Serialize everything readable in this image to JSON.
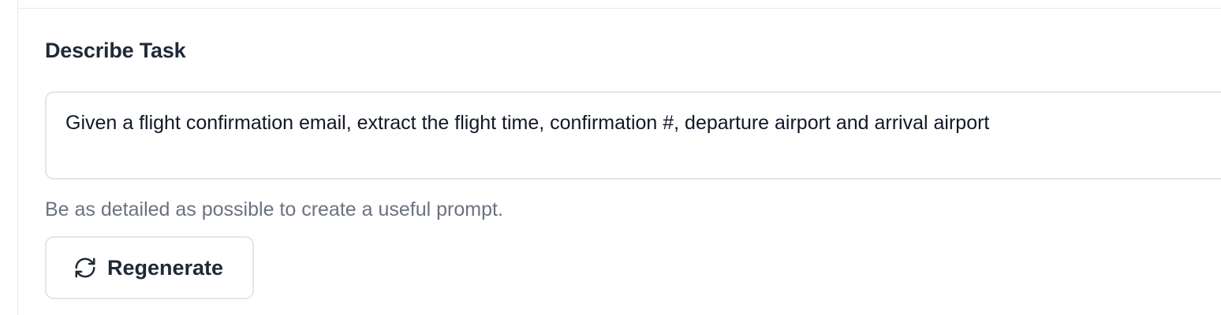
{
  "task_section": {
    "label": "Describe Task",
    "input_value": "Given a flight confirmation email, extract the flight time, confirmation #, departure airport and arrival airport",
    "helper_text": "Be as detailed as possible to create a useful prompt."
  },
  "actions": {
    "regenerate_label": "Regenerate",
    "regenerate_icon": "refresh-icon"
  },
  "colors": {
    "label_text": "#1f2937",
    "input_text": "#111827",
    "helper_text": "#6b7280",
    "border": "#e2e5ea",
    "divider": "#e5e7eb",
    "background": "#ffffff"
  }
}
